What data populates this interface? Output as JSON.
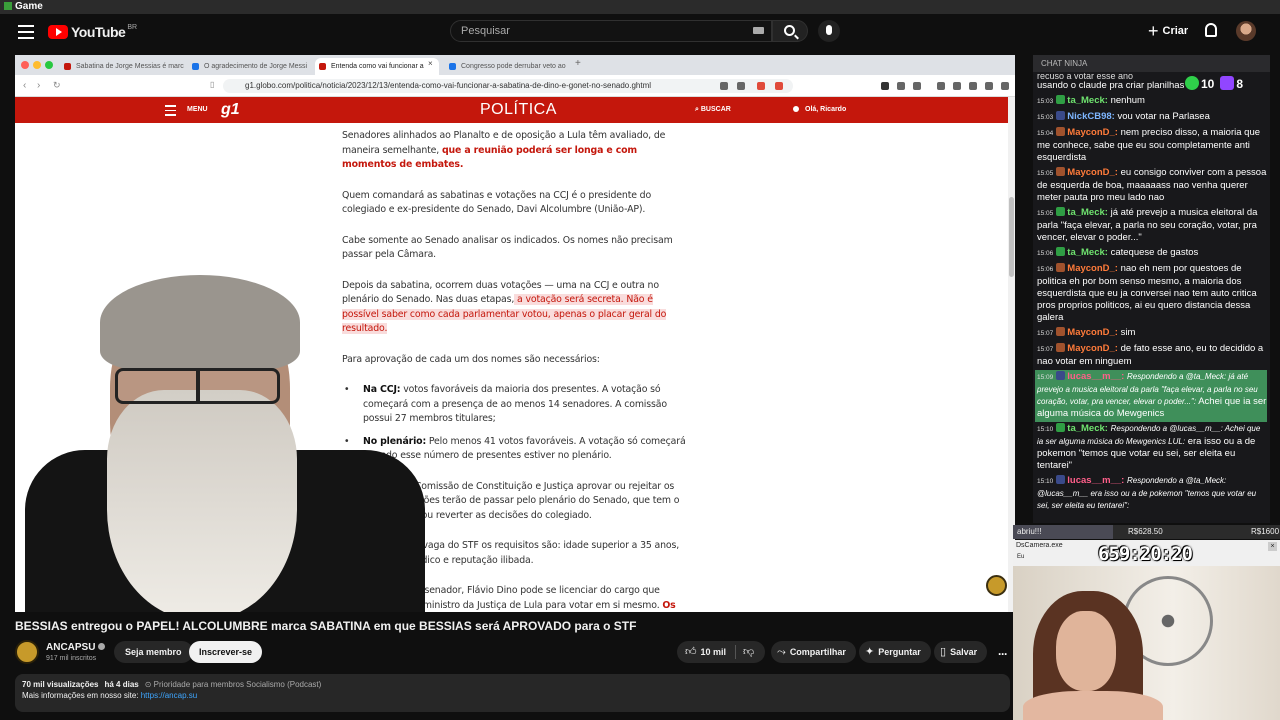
{
  "os_bar": {
    "title": "Game"
  },
  "header": {
    "logo_text": "YouTube",
    "country_code": "BR",
    "search_placeholder": "Pesquisar",
    "create_label": "Criar"
  },
  "browser": {
    "tabs": [
      {
        "label": "Sabatina de Jorge Messias é marc",
        "favicon_color": "#c4170c"
      },
      {
        "label": "O agradecimento de Jorge Messi",
        "favicon_color": "#1a73e8"
      },
      {
        "label": "Entenda como vai funcionar a",
        "favicon_color": "#c4170c"
      },
      {
        "label": "Congresso pode derrubar veto ao",
        "favicon_color": "#1a73e8"
      }
    ],
    "url": "g1.globo.com/politica/noticia/2023/12/13/entenda-como-vai-funcionar-a-sabatina-de-dino-e-gonet-no-senado.ghtml"
  },
  "g1": {
    "menu_label": "MENU",
    "logo": "g1",
    "section": "POLÍTICA",
    "search_label": "BUSCAR",
    "user_label": "Olá, Ricardo"
  },
  "article": {
    "p1_plain": "Senadores alinhados ao Planalto e de oposição a Lula têm avaliado, de maneira semelhante, ",
    "p1_bold": "que a reunião poderá ser longa e com momentos de embates.",
    "p2": "Quem comandará as sabatinas e votações na CCJ é o presidente do colegiado e ex-presidente do Senado, Davi Alcolumbre (União-AP).",
    "p3": "Cabe somente ao Senado analisar os indicados. Os nomes não precisam passar pela Câmara.",
    "p4_plain": "Depois da sabatina, ocorrem duas votações — uma na CCJ e outra no plenário do Senado. Nas duas etapas,",
    "p4_hl": " a votação será secreta. Não é possível saber como cada parlamentar votou, apenas o placar geral do resultado.",
    "p5": "Para aprovação de cada um dos nomes são necessários:",
    "li1_bold": "Na CCJ:",
    "li1_text": " votos favoráveis da maioria dos presentes. A votação só começará com a presença de ao menos 14 senadores. A comissão possui 27 membros titulares;",
    "li2_bold": "No plenário:",
    "li2_text": " Pelo menos 41 votos favoráveis. A votação só começará quando esse número de presentes estiver no plenário.",
    "p6": "Independe se a Comissão de Constituição e Justiça aprovar ou rejeitar os nomes, as indicações terão de passar pelo plenário do Senado, que tem o poder de manter ou reverter as decisões do colegiado.",
    "p7": "Para preencher a vaga do STF os requisitos são: idade superior a 35 anos, notável saber jurídico e reputação ilibada.",
    "p8_plain": "Por ter sido eleito senador, Flávio Dino pode se licenciar do cargo que ocupa hoje como ministro da Justiça de Lula para votar em si mesmo. ",
    "p8_bold": "Os ministros que são senadores, vão fazê-lo:"
  },
  "chat": {
    "title": "CHAT NINJA",
    "counter_a": "10",
    "counter_b": "8",
    "top_fragment": "recuso a votar esse ano",
    "messages": [
      {
        "ts": "",
        "user": "",
        "color": "#ffffff",
        "text": "usando o claude pra criar planilhas",
        "badge": "",
        "hl": false
      },
      {
        "ts": "15:03",
        "user": "ta_Meck:",
        "color": "#6fe36f",
        "text": " nenhum",
        "badge": "#2f9e44",
        "hl": false
      },
      {
        "ts": "15:03",
        "user": "NickCB98:",
        "color": "#7eb6ff",
        "text": " vou votar na Parlasea",
        "badge": "#3a4a8a",
        "hl": false
      },
      {
        "ts": "15:04",
        "user": "MayconD_:",
        "color": "#ff7b3a",
        "text": " nem preciso disso, a maioria que me conhece, sabe que eu sou completamente anti esquerdista",
        "badge": "#a0522d",
        "hl": false
      },
      {
        "ts": "15:05",
        "user": "MayconD_:",
        "color": "#ff7b3a",
        "text": " eu consigo conviver com a pessoa de esquerda de boa, maaaaass nao venha querer meter pauta pro meu lado nao",
        "badge": "#a0522d",
        "hl": false
      },
      {
        "ts": "15:05",
        "user": "ta_Meck:",
        "color": "#6fe36f",
        "text": " já até prevejo a musica eleitoral da parla \"faça elevar, a parla no seu coração, votar, pra vencer, elevar o poder...\"",
        "badge": "#2f9e44",
        "hl": false
      },
      {
        "ts": "15:06",
        "user": "ta_Meck:",
        "color": "#6fe36f",
        "text": " catequese de gastos",
        "badge": "#2f9e44",
        "hl": false
      },
      {
        "ts": "15:06",
        "user": "MayconD_:",
        "color": "#ff7b3a",
        "text": " nao eh nem por questoes de politica eh por bom senso mesmo, a maioria dos esquerdista que eu ja conversei nao tem auto critica pros proprios politicos, ai eu quero distancia dessa galera",
        "badge": "#a0522d",
        "hl": false
      },
      {
        "ts": "15:07",
        "user": "MayconD_:",
        "color": "#ff7b3a",
        "text": " sim",
        "badge": "#a0522d",
        "hl": false
      },
      {
        "ts": "15:07",
        "user": "MayconD_:",
        "color": "#ff7b3a",
        "text": " de fato esse ano, eu to decidido a nao votar em ninguem",
        "badge": "#a0522d",
        "hl": false
      },
      {
        "ts": "15:09",
        "user": "lucas__m__:",
        "color": "#ff5f8a",
        "reply": "Respondendo a @ta_Meck: já até prevejo a musica eleitoral da parla \"faça elevar, a parla no seu coração, votar, pra vencer, elevar o poder...\":",
        "text": " Achei que ia ser alguma música do Mewgenics",
        "badge": "#3a4a8a",
        "hl": true
      },
      {
        "ts": "15:10",
        "user": "ta_Meck:",
        "color": "#6fe36f",
        "reply": "Respondendo a @lucas__m__: Achei que ia ser alguma música do Mewgenics LUL:",
        "text": " era isso ou a de pokemon \"temos que votar eu sei, ser eleita eu tentarei\"",
        "badge": "#2f9e44",
        "hl": false
      },
      {
        "ts": "15:10",
        "user": "lucas__m__:",
        "color": "#ff5f8a",
        "reply": "Respondendo a @ta_Meck: @lucas__m__ era isso ou a de pokemon \"temos que votar eu sei, ser eleita eu tentarei\":",
        "text": "",
        "badge": "#3a4a8a",
        "hl": false
      }
    ]
  },
  "overlay": {
    "abriu_label": "abriu!!!",
    "abriu_value_1": "R$628.50",
    "abriu_value_2": "R$1600",
    "cam_title": "DsCamera.exe",
    "cam_subtitle": "Eu",
    "timer": "659:20:20"
  },
  "video": {
    "title": "BESSIAS entregou o PAPEL! ALCOLUMBRE marca SABATINA em que BESSIAS será APROVADO para o STF",
    "channel": "ANCAPSU",
    "subscribers": "917 mil inscritos",
    "member_label": "Seja membro",
    "subscribe_label": "Inscrever-se",
    "likes": "10 mil",
    "share_label": "Compartilhar",
    "ask_label": "Perguntar",
    "save_label": "Salvar",
    "views": "70 mil visualizações",
    "age": "há 4 dias",
    "tags": "⊙ Prioridade para membros  Socialismo (Podcast)",
    "more_info": "Mais informações em nosso site: ",
    "link": "https://ancap.su"
  }
}
